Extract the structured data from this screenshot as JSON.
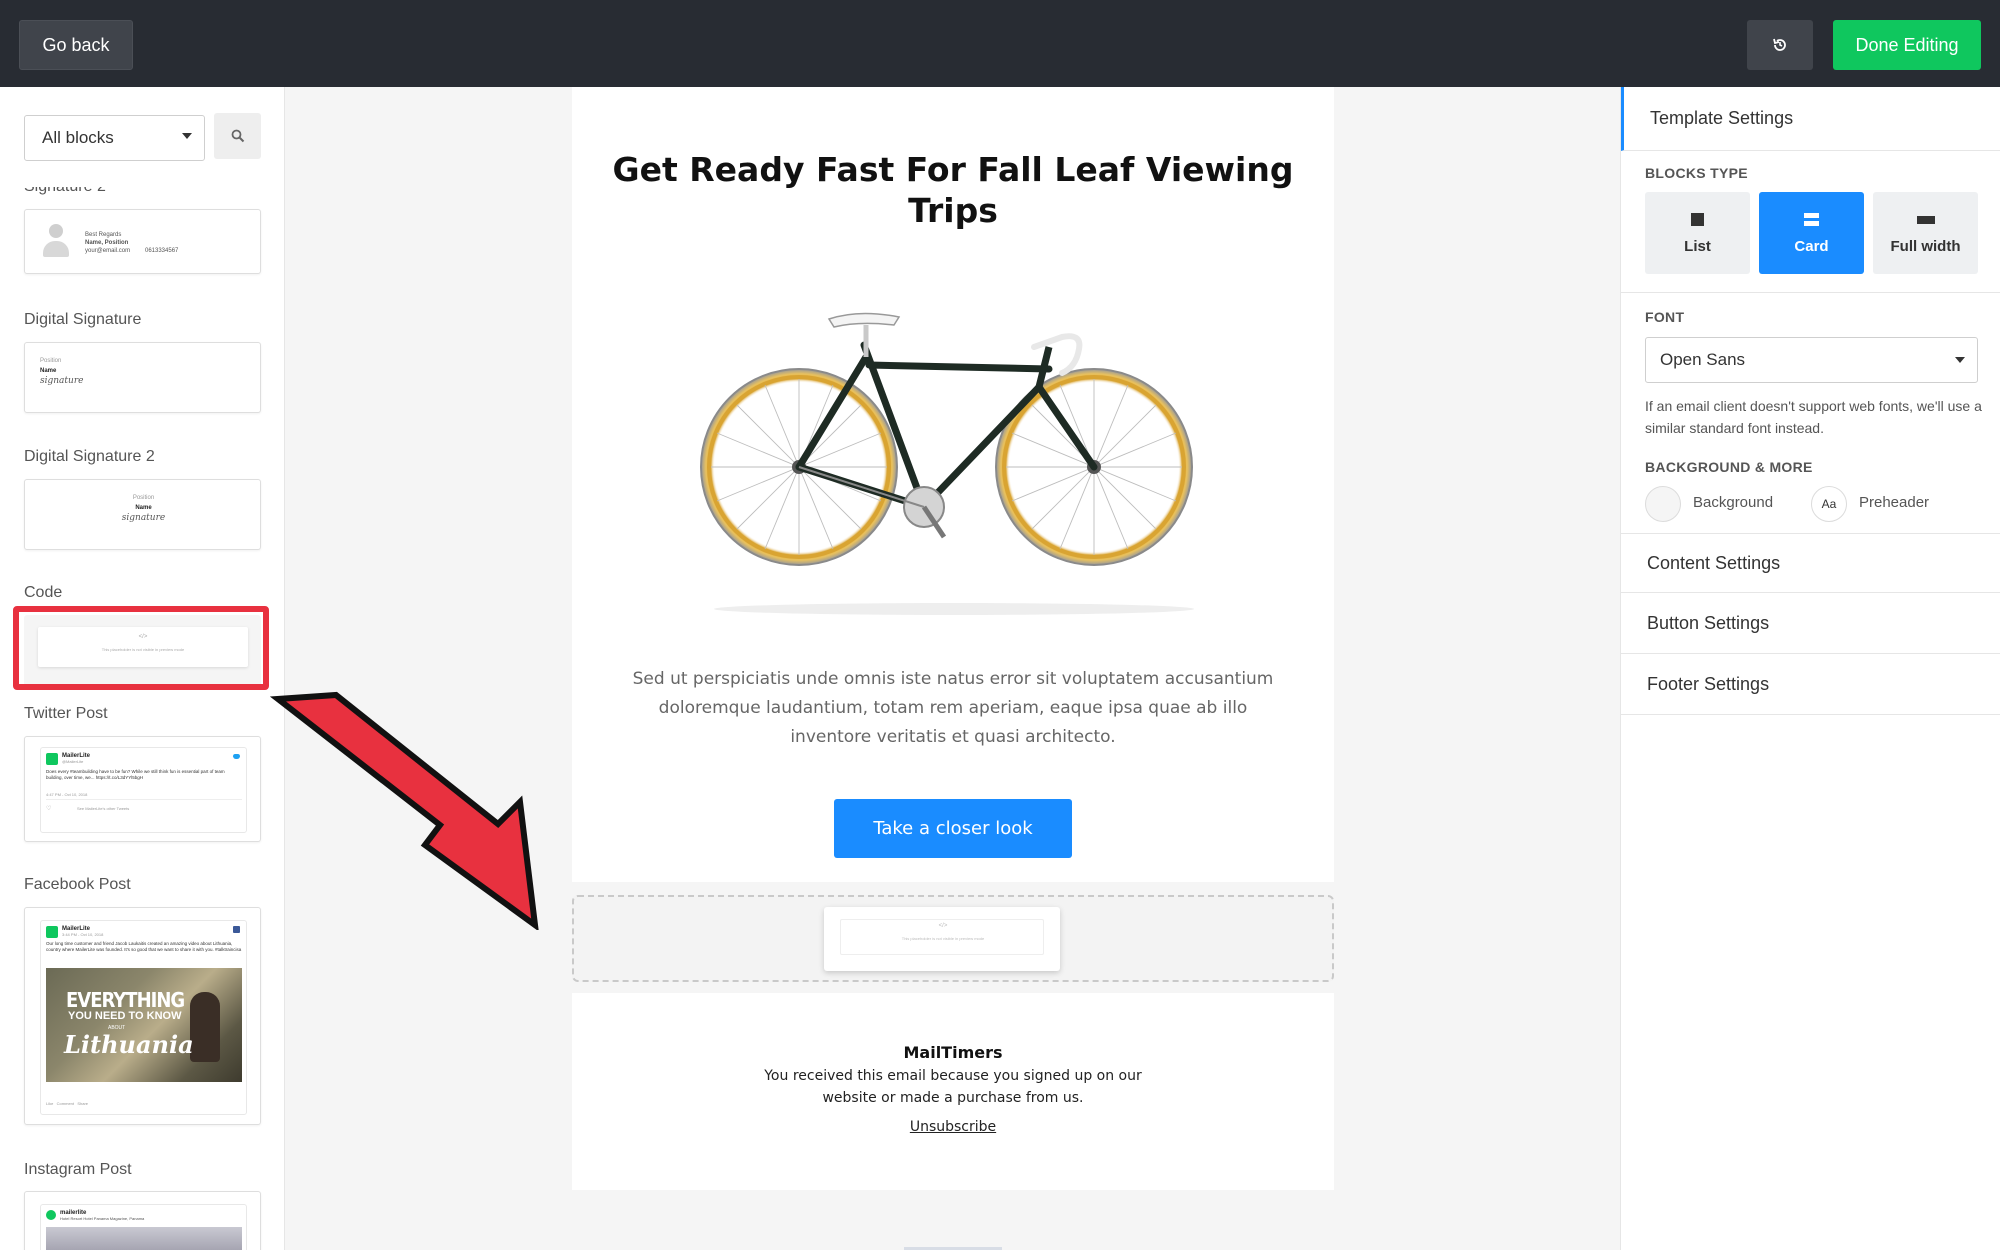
{
  "topbar": {
    "back_label": "Go back",
    "done_label": "Done Editing",
    "history_icon": "history-icon"
  },
  "left": {
    "filter_value": "All blocks",
    "search_icon": "search-icon",
    "partial_label": "Signature 2",
    "signature2_preview": {
      "line1": "Best Regards",
      "line2": "Name, Position",
      "line3": "your@email.com",
      "line4": "0613334567"
    },
    "blocks": [
      {
        "label": "Digital Signature",
        "preview": {
          "small": "Position",
          "name": "Name",
          "sig": "signature"
        }
      },
      {
        "label": "Digital Signature 2",
        "preview": {
          "small": "Position",
          "name": "Name",
          "sig": "signature"
        }
      },
      {
        "label": "Code",
        "preview": {
          "small": "</>",
          "text": "This placeholder is not visible in preview mode"
        }
      },
      {
        "label": "Twitter Post",
        "preview": {
          "account": "MailerLite",
          "handle": "@MailerLite",
          "text": "Does every #teambuilding have to be fun? While we still think fun is essential part of team building, over time, we... https://t.co/L3dYYl5bgH",
          "time": "4:47 PM - Oct 10, 2018",
          "meta": "See MailerLite's other Tweets"
        }
      },
      {
        "label": "Facebook Post",
        "preview": {
          "account": "MailerLite",
          "date": "3:44 PM - Oct 10, 2018",
          "text": "Our long time customer and friend Jacob Laukaitis created an amazing video about Lithuania, country where MailerLite was founded. It's so good that we want to share it with you. #talktraincisa",
          "img_l1": "EVERYTHING",
          "img_l2": "YOU NEED TO KNOW",
          "img_l3": "ABOUT",
          "img_l4": "Lithuania",
          "actions": "Like   Comment   Share"
        }
      },
      {
        "label": "Instagram Post",
        "preview": {
          "account": "mailerlite",
          "location": "Hotel Resort Hotel Panama Magazine, Panama"
        }
      }
    ]
  },
  "email": {
    "title": "Get Ready Fast For Fall Leaf Viewing Trips",
    "body": "Sed ut perspiciatis unde omnis iste natus error sit voluptatem accusantium doloremque laudantium, totam rem aperiam, eaque ipsa quae ab illo inventore veritatis et quasi architecto.",
    "cta": "Take a closer look",
    "drop_placeholder": "This placeholder is not visible in preview mode",
    "footer": {
      "name": "MailTimers",
      "text": "You received this email because you signed up on our website or made a purchase from us.",
      "unsubscribe": "Unsubscribe"
    }
  },
  "right": {
    "template_settings": "Template Settings",
    "blocks_type_caption": "BLOCKS TYPE",
    "block_types": [
      {
        "label": "List",
        "icon": "square-icon",
        "active": false
      },
      {
        "label": "Card",
        "icon": "card-icon",
        "active": true
      },
      {
        "label": "Full width",
        "icon": "full-width-icon",
        "active": false
      }
    ],
    "font_caption": "FONT",
    "font_value": "Open Sans",
    "font_hint": "If an email client doesn't support web fonts, we'll use a similar standard font instead.",
    "bg_caption": "BACKGROUND & MORE",
    "background_label": "Background",
    "preheader_label": "Preheader",
    "preheader_swatch": "Aa",
    "sections": [
      "Content Settings",
      "Button Settings",
      "Footer Settings"
    ]
  },
  "colors": {
    "topbar": "#282c33",
    "done": "#0fc75e",
    "accent": "#1a8cff",
    "annotation_red": "#e8313f"
  }
}
